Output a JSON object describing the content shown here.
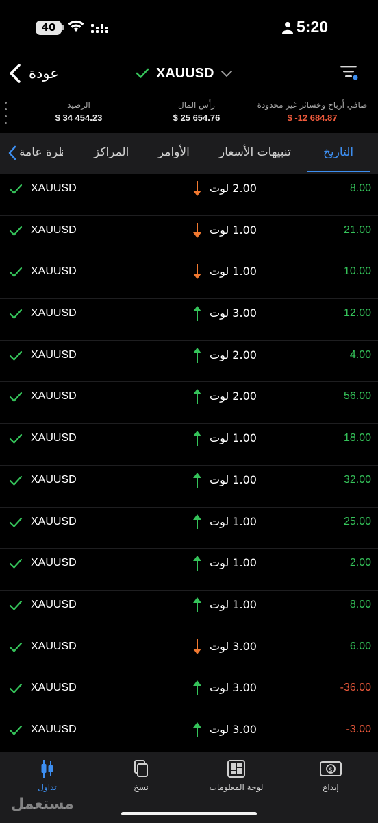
{
  "status_bar": {
    "battery": "40",
    "time": "5:20"
  },
  "header": {
    "back_label": "عودة",
    "symbol": "XAUUSD"
  },
  "summary": {
    "balance_label": "الرصيد",
    "balance_value": "$ 34 454.23",
    "equity_label": "رأس المال",
    "equity_value": "$ 25 654.76",
    "pl_label": "صافي أرباح وخسائر غير محدودة",
    "pl_value": "$ -12 684.87"
  },
  "tabs": {
    "history": "التاريخ",
    "alerts": "تنبيهات الأسعار",
    "orders": "الأوامر",
    "positions": "المراكز",
    "overview": "نظرة عامة"
  },
  "trades": [
    {
      "symbol": "XAUUSD",
      "direction": "down",
      "lot": "2.00 لوت",
      "profit": "8.00",
      "positive": true
    },
    {
      "symbol": "XAUUSD",
      "direction": "down",
      "lot": "1.00 لوت",
      "profit": "21.00",
      "positive": true
    },
    {
      "symbol": "XAUUSD",
      "direction": "down",
      "lot": "1.00 لوت",
      "profit": "10.00",
      "positive": true
    },
    {
      "symbol": "XAUUSD",
      "direction": "up",
      "lot": "3.00 لوت",
      "profit": "12.00",
      "positive": true
    },
    {
      "symbol": "XAUUSD",
      "direction": "up",
      "lot": "2.00 لوت",
      "profit": "4.00",
      "positive": true
    },
    {
      "symbol": "XAUUSD",
      "direction": "up",
      "lot": "2.00 لوت",
      "profit": "56.00",
      "positive": true
    },
    {
      "symbol": "XAUUSD",
      "direction": "up",
      "lot": "1.00 لوت",
      "profit": "18.00",
      "positive": true
    },
    {
      "symbol": "XAUUSD",
      "direction": "up",
      "lot": "1.00 لوت",
      "profit": "32.00",
      "positive": true
    },
    {
      "symbol": "XAUUSD",
      "direction": "up",
      "lot": "1.00 لوت",
      "profit": "25.00",
      "positive": true
    },
    {
      "symbol": "XAUUSD",
      "direction": "up",
      "lot": "1.00 لوت",
      "profit": "2.00",
      "positive": true
    },
    {
      "symbol": "XAUUSD",
      "direction": "up",
      "lot": "1.00 لوت",
      "profit": "8.00",
      "positive": true
    },
    {
      "symbol": "XAUUSD",
      "direction": "down",
      "lot": "3.00 لوت",
      "profit": "6.00",
      "positive": true
    },
    {
      "symbol": "XAUUSD",
      "direction": "up",
      "lot": "3.00 لوت",
      "profit": "-36.00",
      "positive": false
    },
    {
      "symbol": "XAUUSD",
      "direction": "up",
      "lot": "3.00 لوت",
      "profit": "-3.00",
      "positive": false
    }
  ],
  "bottom_nav": {
    "trade": "تداول",
    "copy": "نسخ",
    "dashboard": "لوحة المعلومات",
    "deposit": "إيداع"
  },
  "watermark": "مستعمل",
  "colors": {
    "accent": "#3d8ef0",
    "profit": "#35c35a",
    "loss": "#ef5a3c",
    "down_arrow": "#f07830",
    "background": "#000000"
  }
}
